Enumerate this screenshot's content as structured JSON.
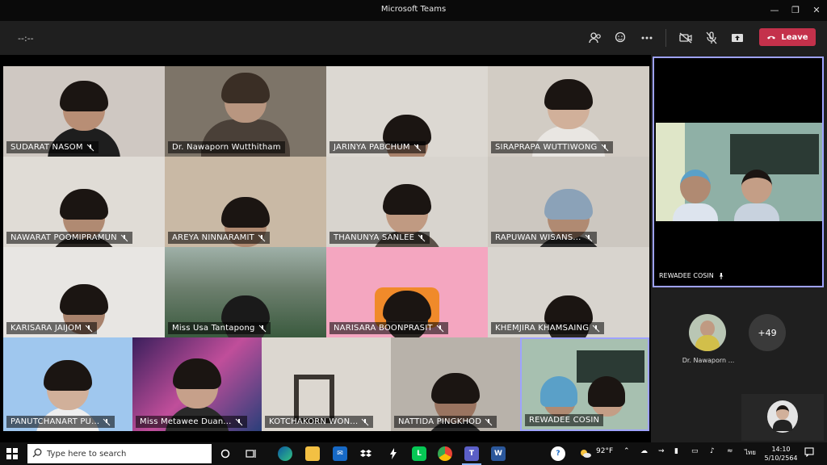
{
  "window": {
    "title": "Microsoft Teams"
  },
  "toolbar": {
    "timer": "--:--",
    "leave_label": "Leave"
  },
  "participants": [
    {
      "name": "SUDARAT NASOM"
    },
    {
      "name": "Dr. Nawaporn Wutthitham"
    },
    {
      "name": "JARINYA PABCHUM"
    },
    {
      "name": "SIRAPRAPA WUTTIWONG"
    },
    {
      "name": "NAWARAT POOMIPRAMUN"
    },
    {
      "name": "AREYA NINNARAMIT"
    },
    {
      "name": "THANUNYA SANLEE"
    },
    {
      "name": "RAPUWAN WISANS..."
    },
    {
      "name": "KARISARA JAIJOM"
    },
    {
      "name": "Miss Usa Tantapong"
    },
    {
      "name": "NARISARA BOONPRASIT"
    },
    {
      "name": "KHEMJIRA KHAMSAING"
    },
    {
      "name": "PANUTCHANART PU..."
    },
    {
      "name": "Miss Metawee Duan..."
    },
    {
      "name": "KOTCHAKORN WON..."
    },
    {
      "name": "NATTIDA PINGKHOD"
    },
    {
      "name": "REWADEE COSIN"
    }
  ],
  "pinned": {
    "name": "REWADEE COSIN"
  },
  "overflow": {
    "avatar_name": "Dr. Nawaporn ...",
    "more_count": "+49"
  },
  "taskbar": {
    "search_placeholder": "Type here to search",
    "weather": "92°F",
    "language": "ไทย",
    "time": "14:10",
    "date": "5/10/2564"
  }
}
